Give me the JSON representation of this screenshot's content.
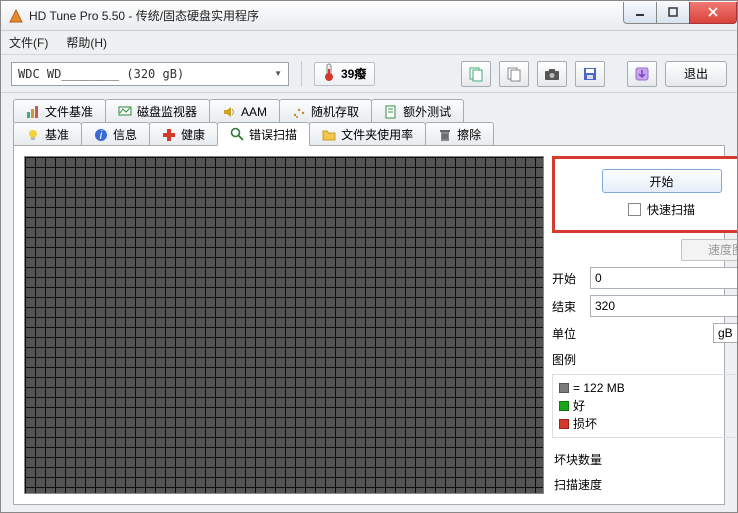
{
  "window": {
    "title": "HD Tune Pro 5.50 - 传统/固态硬盘实用程序"
  },
  "menu": {
    "file": "文件(F)",
    "help": "帮助(H)"
  },
  "toolbar": {
    "drive_text": "WDC WD________ (320 gB)",
    "temperature": "39癈",
    "exit_label": "退出"
  },
  "tabs_top": [
    {
      "label": "文件基准",
      "icon": "chart-icon"
    },
    {
      "label": "磁盘监视器",
      "icon": "monitor-icon"
    },
    {
      "label": "AAM",
      "icon": "speaker-icon"
    },
    {
      "label": "随机存取",
      "icon": "spark-icon"
    },
    {
      "label": "额外测试",
      "icon": "page-icon"
    }
  ],
  "tabs_bottom": [
    {
      "label": "基准",
      "icon": "bulb-icon"
    },
    {
      "label": "信息",
      "icon": "info-icon"
    },
    {
      "label": "健康",
      "icon": "plus-icon"
    },
    {
      "label": "错误扫描",
      "icon": "search-icon",
      "active": true
    },
    {
      "label": "文件夹使用率",
      "icon": "folder-icon"
    },
    {
      "label": "擦除",
      "icon": "trash-icon"
    }
  ],
  "scan": {
    "start_label": "开始",
    "quick_label": "快速扫描",
    "speedmap_label": "速度图",
    "start_field_label": "开始",
    "start_value": "0",
    "end_field_label": "结束",
    "end_value": "320",
    "unit_label": "单位",
    "unit_value": "gB",
    "legend_title": "图例",
    "legend_block": "= 122 MB",
    "legend_good": "好",
    "legend_bad": "损坏",
    "stats": {
      "bad_blocks_label": "坏块数量",
      "bad_blocks_value": "-",
      "scan_speed_label": "扫描速度",
      "scan_speed_value": "-"
    }
  },
  "colors": {
    "good": "#1aa51a",
    "bad": "#d43a2a",
    "unscanned": "#7a7a7a"
  }
}
